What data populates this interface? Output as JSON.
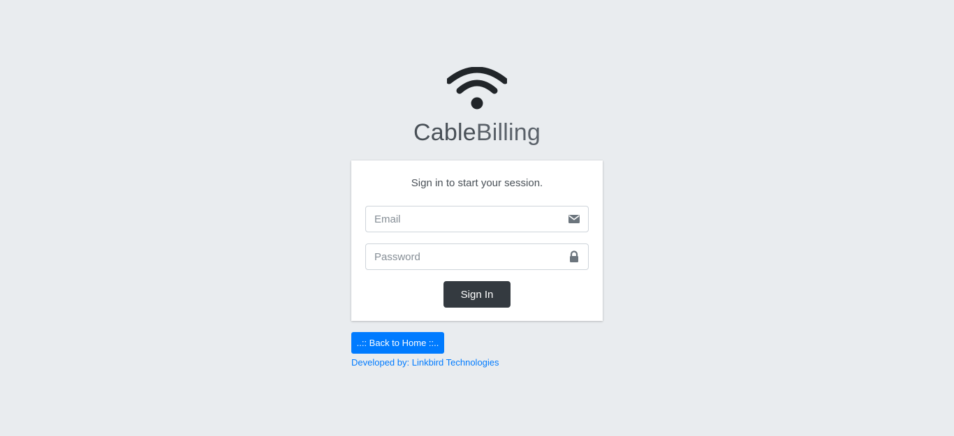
{
  "logo": {
    "icon": "wifi-icon",
    "brand_part1": "Cable",
    "brand_part2": "Billing",
    "icon_color": "#212529"
  },
  "login": {
    "message": "Sign in to start your session.",
    "email": {
      "placeholder": "Email",
      "value": "",
      "icon": "envelope-icon"
    },
    "password": {
      "placeholder": "Password",
      "value": "",
      "icon": "lock-icon"
    },
    "submit_label": "Sign In"
  },
  "footer": {
    "back_home_label": "..:: Back to Home ::..",
    "developed_by_prefix": "Developed by: ",
    "developer_name": "Linkbird Technologies"
  },
  "colors": {
    "background": "#e9ecef",
    "primary": "#007bff",
    "dark_button": "#343a40"
  }
}
